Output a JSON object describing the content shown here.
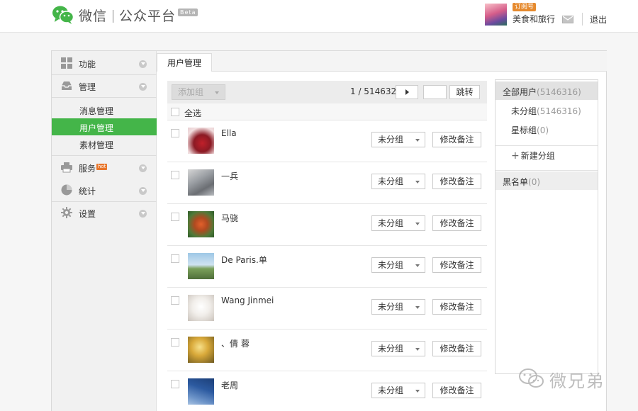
{
  "header": {
    "product": "微信",
    "product_sub": "公众平台",
    "beta": "Beta",
    "account_badge": "订阅号",
    "account_name": "美食和旅行",
    "logout": "退出"
  },
  "nav": {
    "sections": [
      {
        "label": "功能",
        "icon": "grid-icon"
      },
      {
        "label": "管理",
        "icon": "inbox-icon"
      },
      {
        "label": "服务",
        "icon": "printer-icon",
        "badge": "hot"
      },
      {
        "label": "统计",
        "icon": "pie-chart-icon"
      },
      {
        "label": "设置",
        "icon": "gear-icon"
      }
    ],
    "sub_items": [
      "消息管理",
      "用户管理",
      "素材管理"
    ],
    "active_sub": "用户管理"
  },
  "tab": "用户管理",
  "toolbar": {
    "add_group": "添加组",
    "pager": "1 / 514632",
    "jump": "跳转",
    "select_all": "全选"
  },
  "users": [
    {
      "name": "Ella",
      "group": "未分组",
      "remark": "修改备注"
    },
    {
      "name": "一兵",
      "group": "未分组",
      "remark": "修改备注"
    },
    {
      "name": "马骁",
      "group": "未分组",
      "remark": "修改备注"
    },
    {
      "name": "De Paris.单",
      "group": "未分组",
      "remark": "修改备注"
    },
    {
      "name": "Wang Jinmei",
      "group": "未分组",
      "remark": "修改备注"
    },
    {
      "name": "、倩 蓉",
      "group": "未分组",
      "remark": "修改备注"
    },
    {
      "name": "老周",
      "group": "未分组",
      "remark": "修改备注"
    }
  ],
  "groups": {
    "all_label": "全部用户",
    "all_count": "(5146316)",
    "ungrouped_label": "未分组",
    "ungrouped_count": "(5146316)",
    "star_label": "星标组",
    "star_count": "(0)",
    "new_group": "新建分组",
    "blacklist_label": "黑名单",
    "blacklist_count": "(0)"
  },
  "watermark": "微兄弟",
  "colors": {
    "accent": "#44b549",
    "badge": "#e68a2e"
  }
}
